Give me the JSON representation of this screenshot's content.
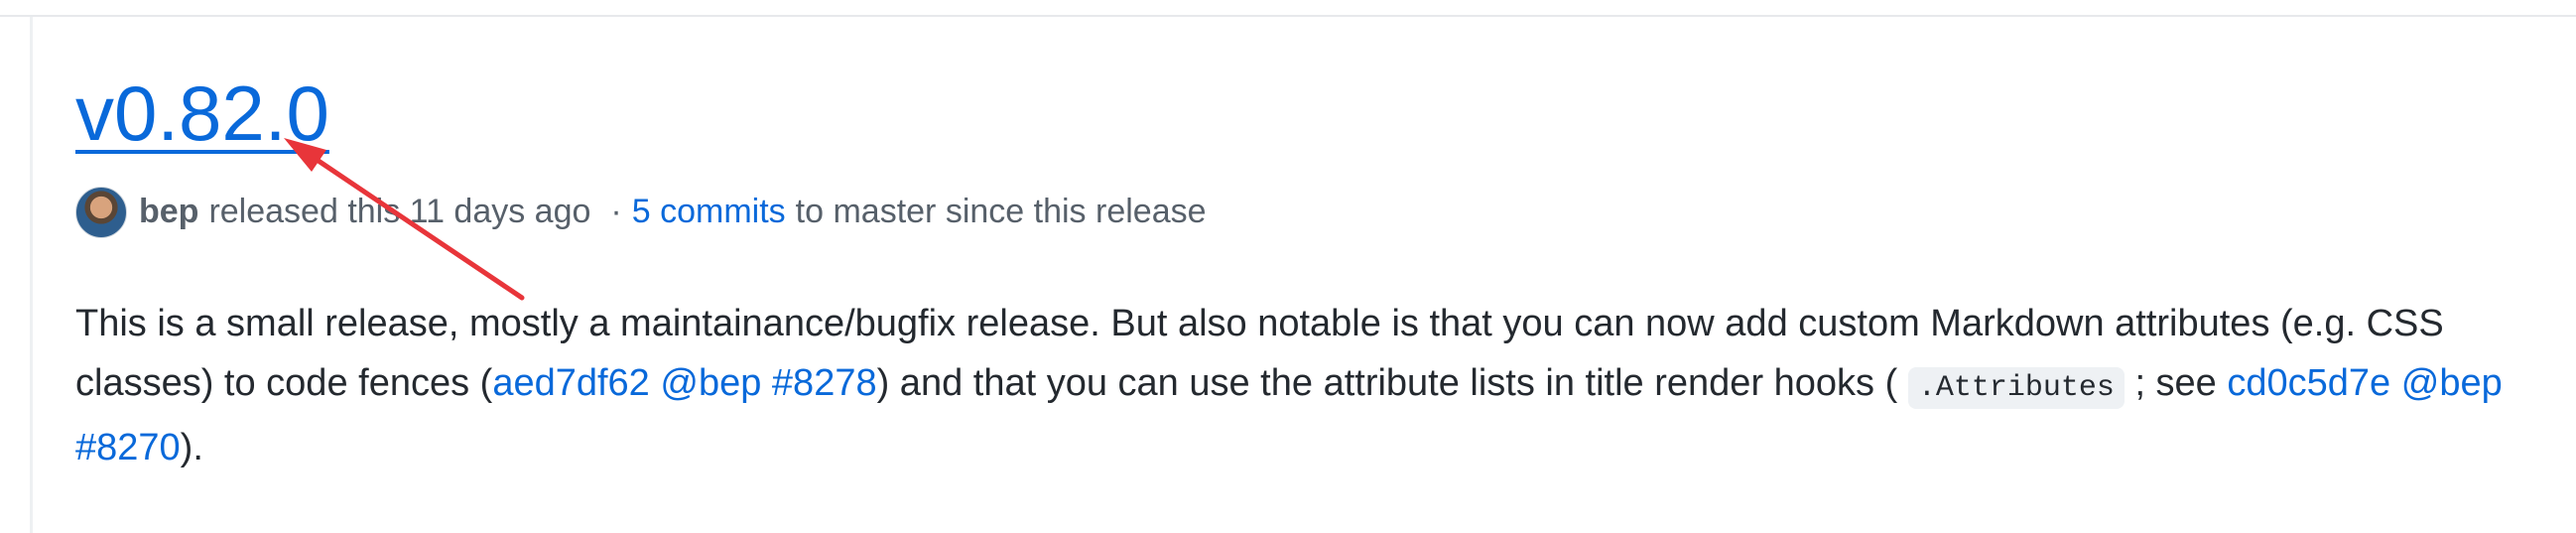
{
  "release": {
    "title": "v0.82.0",
    "author": "bep",
    "released_text": "released this 11 days ago",
    "separator": "·",
    "commits_link": "5 commits",
    "commits_suffix": "to master since this release"
  },
  "notes": {
    "p1": "This is a small release, mostly a maintainance/bugfix release. But also notable is that you can now add custom Markdown attributes (e.g. CSS classes) to code fences (",
    "commit1": "aed7df62",
    "mention1": "@bep",
    "issue1": "#8278",
    "p2": ") and that you can use the attribute lists in title render hooks (",
    "code1": ".Attributes",
    "p3": "; see",
    "commit2": "cd0c5d7e",
    "mention2": "@bep",
    "issue2": "#8270",
    "p4": ")."
  },
  "colors": {
    "link": "#0969da",
    "text": "#24292f",
    "muted": "#57606a",
    "annotation_arrow": "#e8353a"
  },
  "icons": {
    "avatar": "avatar-image",
    "annotation": "red-arrow-annotation"
  }
}
